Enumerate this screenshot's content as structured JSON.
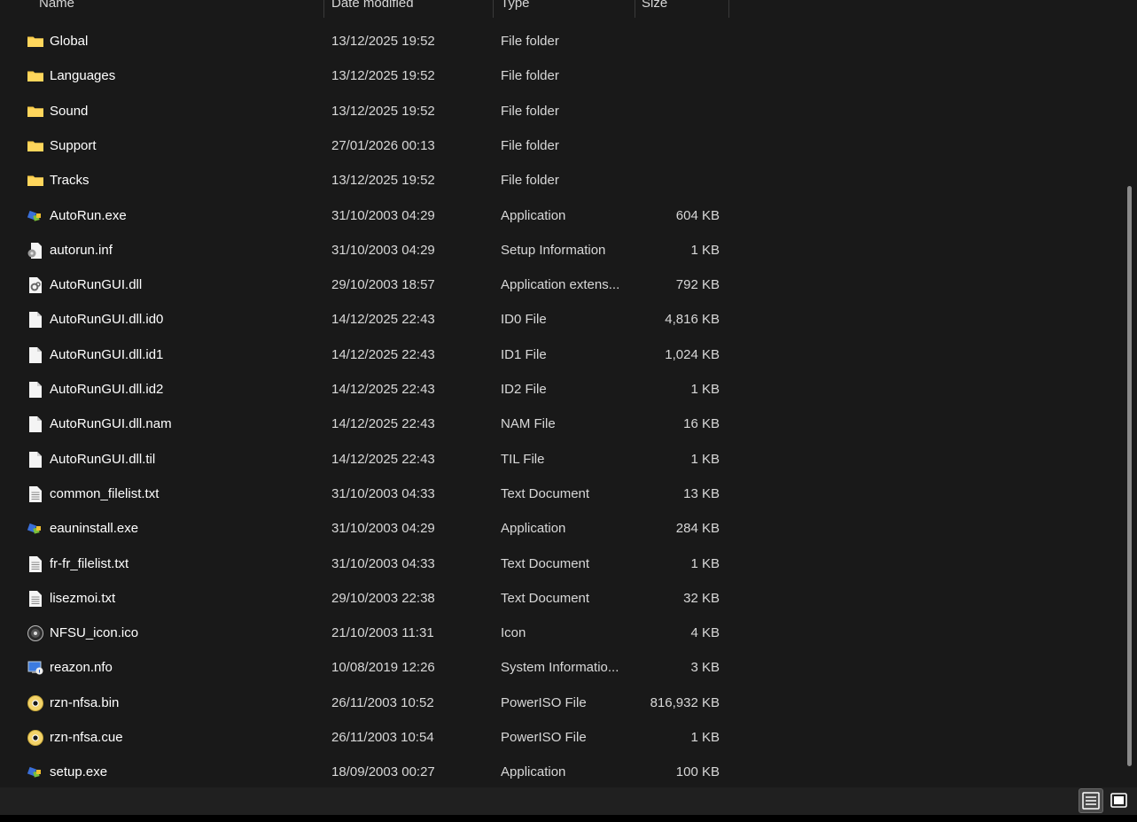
{
  "columns": {
    "name": "Name",
    "date": "Date modified",
    "type": "Type",
    "size": "Size"
  },
  "files": [
    {
      "name": "Global",
      "date": "13/12/2025 19:52",
      "type": "File folder",
      "size": "",
      "icon": "folder-icon"
    },
    {
      "name": "Languages",
      "date": "13/12/2025 19:52",
      "type": "File folder",
      "size": "",
      "icon": "folder-icon"
    },
    {
      "name": "Sound",
      "date": "13/12/2025 19:52",
      "type": "File folder",
      "size": "",
      "icon": "folder-icon"
    },
    {
      "name": "Support",
      "date": "27/01/2026 00:13",
      "type": "File folder",
      "size": "",
      "icon": "folder-icon"
    },
    {
      "name": "Tracks",
      "date": "13/12/2025 19:52",
      "type": "File folder",
      "size": "",
      "icon": "folder-icon"
    },
    {
      "name": "AutoRun.exe",
      "date": "31/10/2003 04:29",
      "type": "Application",
      "size": "604 KB",
      "icon": "application-icon"
    },
    {
      "name": "autorun.inf",
      "date": "31/10/2003 04:29",
      "type": "Setup Information",
      "size": "1 KB",
      "icon": "setup-info-icon"
    },
    {
      "name": "AutoRunGUI.dll",
      "date": "29/10/2003 18:57",
      "type": "Application extens...",
      "size": "792 KB",
      "icon": "dll-icon"
    },
    {
      "name": "AutoRunGUI.dll.id0",
      "date": "14/12/2025 22:43",
      "type": "ID0 File",
      "size": "4,816 KB",
      "icon": "generic-file-icon"
    },
    {
      "name": "AutoRunGUI.dll.id1",
      "date": "14/12/2025 22:43",
      "type": "ID1 File",
      "size": "1,024 KB",
      "icon": "generic-file-icon"
    },
    {
      "name": "AutoRunGUI.dll.id2",
      "date": "14/12/2025 22:43",
      "type": "ID2 File",
      "size": "1 KB",
      "icon": "generic-file-icon"
    },
    {
      "name": "AutoRunGUI.dll.nam",
      "date": "14/12/2025 22:43",
      "type": "NAM File",
      "size": "16 KB",
      "icon": "generic-file-icon"
    },
    {
      "name": "AutoRunGUI.dll.til",
      "date": "14/12/2025 22:43",
      "type": "TIL File",
      "size": "1 KB",
      "icon": "generic-file-icon"
    },
    {
      "name": "common_filelist.txt",
      "date": "31/10/2003 04:33",
      "type": "Text Document",
      "size": "13 KB",
      "icon": "text-document-icon"
    },
    {
      "name": "eauninstall.exe",
      "date": "31/10/2003 04:29",
      "type": "Application",
      "size": "284 KB",
      "icon": "application-icon"
    },
    {
      "name": "fr-fr_filelist.txt",
      "date": "31/10/2003 04:33",
      "type": "Text Document",
      "size": "1 KB",
      "icon": "text-document-icon"
    },
    {
      "name": "lisezmoi.txt",
      "date": "29/10/2003 22:38",
      "type": "Text Document",
      "size": "32 KB",
      "icon": "text-document-icon"
    },
    {
      "name": "NFSU_icon.ico",
      "date": "21/10/2003 11:31",
      "type": "Icon",
      "size": "4 KB",
      "icon": "ico-file-icon"
    },
    {
      "name": "reazon.nfo",
      "date": "10/08/2019 12:26",
      "type": "System Informatio...",
      "size": "3 KB",
      "icon": "system-info-icon"
    },
    {
      "name": "rzn-nfsa.bin",
      "date": "26/11/2003 10:52",
      "type": "PowerISO File",
      "size": "816,932 KB",
      "icon": "disc-image-icon"
    },
    {
      "name": "rzn-nfsa.cue",
      "date": "26/11/2003 10:54",
      "type": "PowerISO File",
      "size": "1 KB",
      "icon": "disc-image-icon"
    },
    {
      "name": "setup.exe",
      "date": "18/09/2003 00:27",
      "type": "Application",
      "size": "100 KB",
      "icon": "application-icon"
    }
  ],
  "colors": {
    "background": "#191919",
    "folder": "#f7c948",
    "text": "#ffffff"
  }
}
